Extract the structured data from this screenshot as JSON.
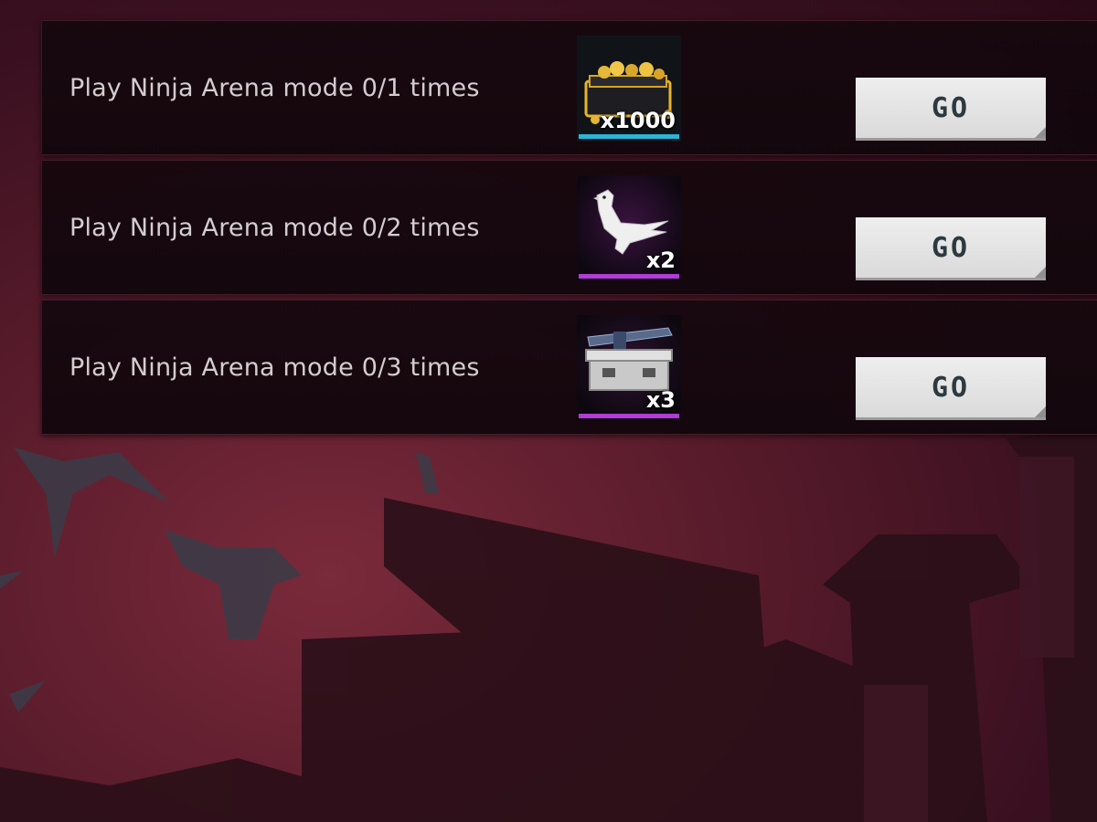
{
  "tasks": [
    {
      "text": "Play Ninja Arena mode 0/1 times",
      "reward_icon": "gold-chest-icon",
      "reward_qty": "x1000",
      "rarity_color": "#2bb5d9",
      "button_label": "GO"
    },
    {
      "text": "Play Ninja Arena mode 0/2 times",
      "reward_icon": "white-bird-icon",
      "reward_qty": "x2",
      "rarity_color": "#b13cd6",
      "button_label": "GO"
    },
    {
      "text": "Play Ninja Arena mode 0/3 times",
      "reward_icon": "weapon-crate-icon",
      "reward_qty": "x3",
      "rarity_color": "#b13cd6",
      "button_label": "GO"
    }
  ]
}
